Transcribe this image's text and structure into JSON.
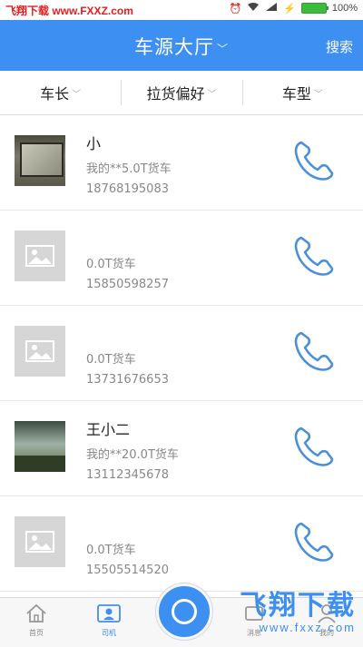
{
  "statusbar": {
    "watermark": "飞翔下载 www.FXXZ.com",
    "battery_text": "100%"
  },
  "header": {
    "title": "车源大厅",
    "search_label": "搜索",
    "background": "#3d8ff2"
  },
  "filters": [
    {
      "label": "车长"
    },
    {
      "label": "拉货偏好"
    },
    {
      "label": "车型"
    }
  ],
  "listings": [
    {
      "name": "小",
      "desc": "我的**5.0T货车",
      "phone": "18768195083",
      "thumb": "photo"
    },
    {
      "name": "",
      "desc": "0.0T货车",
      "phone": "15850598257",
      "thumb": "placeholder"
    },
    {
      "name": "",
      "desc": "0.0T货车",
      "phone": "13731676653",
      "thumb": "placeholder"
    },
    {
      "name": "王小二",
      "desc": "我的**20.0T货车",
      "phone": "13112345678",
      "thumb": "photo"
    },
    {
      "name": "",
      "desc": "0.0T货车",
      "phone": "15505514520",
      "thumb": "placeholder"
    }
  ],
  "bottom_nav": [
    {
      "label": "首页",
      "icon": "home-icon"
    },
    {
      "label": "司机",
      "icon": "driver-icon"
    },
    {
      "label": "",
      "icon": "center-action-icon"
    },
    {
      "label": "消息",
      "icon": "message-icon"
    },
    {
      "label": "我的",
      "icon": "profile-icon"
    }
  ],
  "corner_watermark": {
    "big": "飞翔下载",
    "small": "www.fxxz.com"
  }
}
